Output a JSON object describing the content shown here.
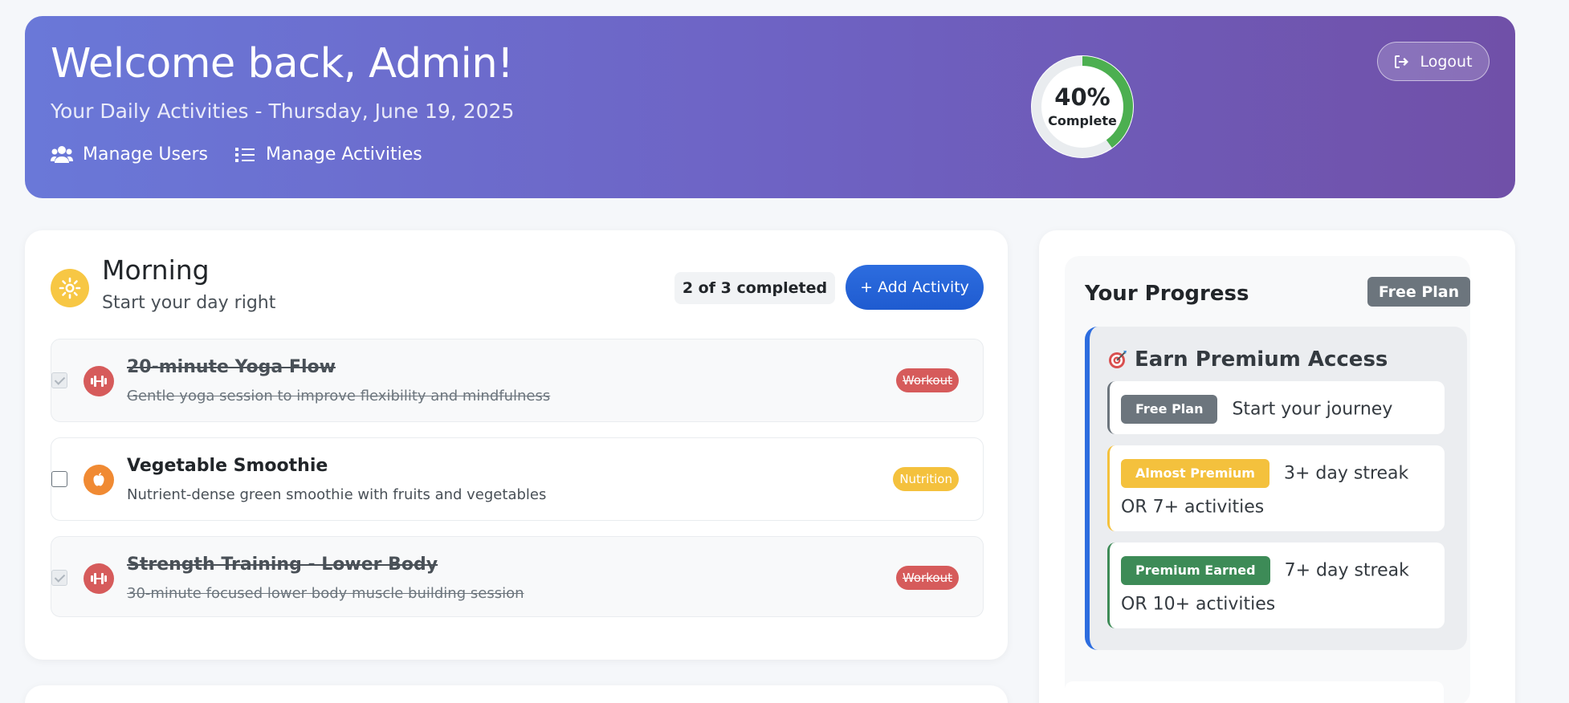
{
  "header": {
    "title": "Welcome back, Admin!",
    "subtitle": "Your Daily Activities - Thursday, June 19, 2025",
    "nav": [
      {
        "label": "Manage Users",
        "icon": "users-icon"
      },
      {
        "label": "Manage Activities",
        "icon": "list-icon"
      }
    ],
    "progress": {
      "value": 40,
      "percent_label": "40%",
      "label": "Complete"
    },
    "logout_label": "Logout"
  },
  "morning": {
    "title": "Morning",
    "subtitle": "Start your day right",
    "completed_label": "2 of 3 completed",
    "add_label": "+ Add Activity",
    "activities": [
      {
        "title": "20-minute Yoga Flow",
        "desc": "Gentle yoga session to improve flexibility and mindfulness",
        "tag": "Workout",
        "done": true,
        "icon": "dumbbell-icon"
      },
      {
        "title": "Vegetable Smoothie",
        "desc": "Nutrient-dense green smoothie with fruits and vegetables",
        "tag": "Nutrition",
        "done": false,
        "icon": "apple-icon"
      },
      {
        "title": "Strength Training - Lower Body",
        "desc": "30-minute focused lower body muscle building session",
        "tag": "Workout",
        "done": true,
        "icon": "dumbbell-icon"
      }
    ]
  },
  "progress_panel": {
    "title": "Your Progress",
    "plan_badge": "Free Plan",
    "premium_title": "Earn Premium Access",
    "tiers": [
      {
        "badge": "Free Plan",
        "text": "Start your journey",
        "color": "#6c757d"
      },
      {
        "badge": "Almost Premium",
        "text": "3+ day streak OR 7+ activities",
        "color": "#f4c13d"
      },
      {
        "badge": "Premium Earned",
        "text": "7+ day streak OR 10+ activities",
        "color": "#3d8b57"
      }
    ]
  },
  "colors": {
    "accent": "#2d6ddf",
    "workout": "#d65b5b",
    "nutrition": "#f4c13d",
    "nutrition_icon": "#f08a33",
    "ring_progress": "#4caf50",
    "sun": "#f7c744"
  }
}
